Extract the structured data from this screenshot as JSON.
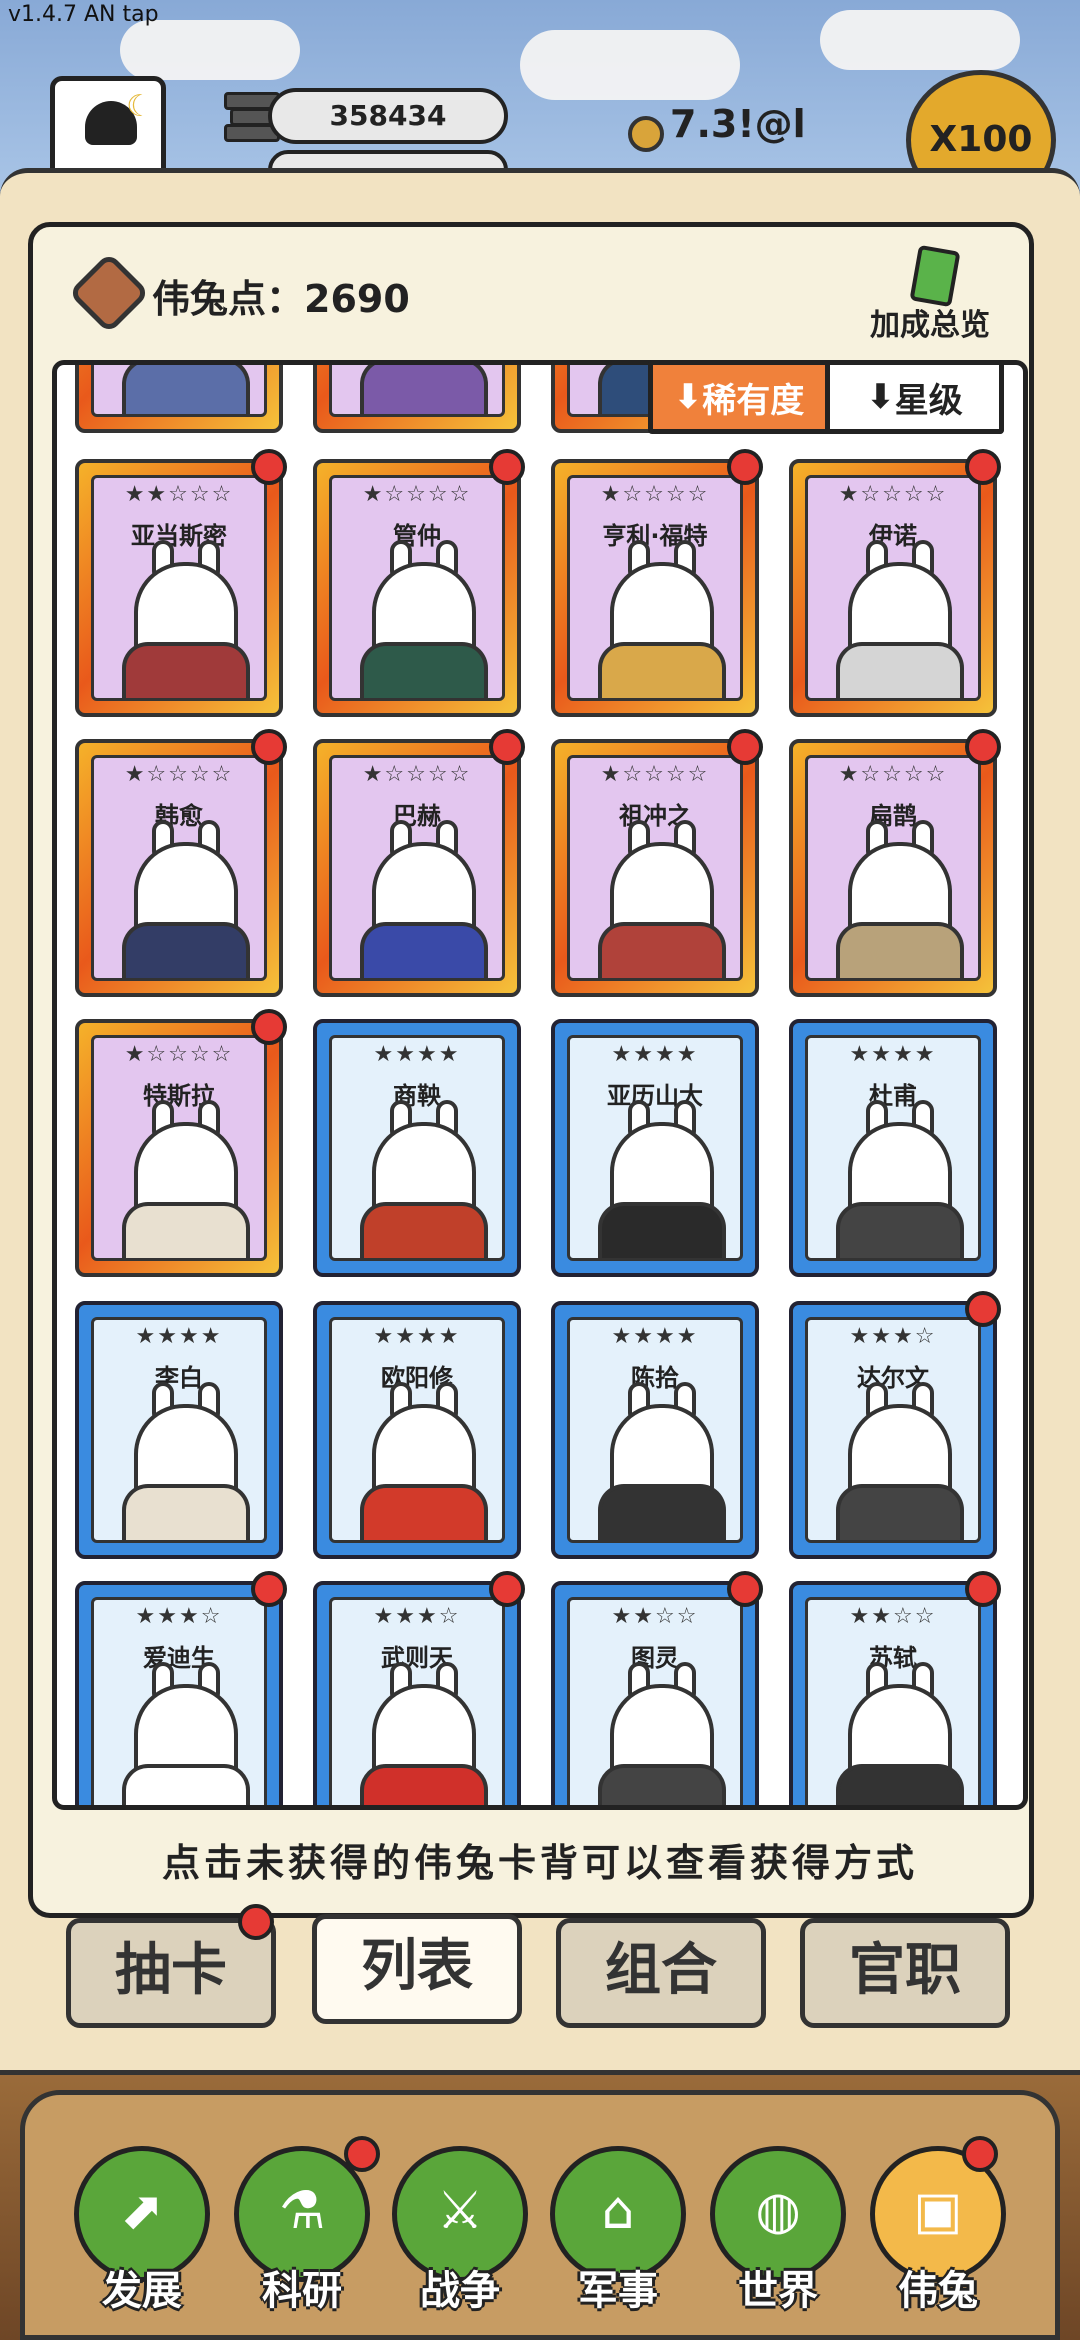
{
  "version": "v1.4.7 AN tap",
  "top": {
    "gold": "358434",
    "currency": "7.3!@l",
    "multiplier": "X100"
  },
  "points": {
    "label": "伟兔点：",
    "value": "2690"
  },
  "bonus_label": "加成总览",
  "sort": {
    "rarity": "稀有度",
    "star": "星级"
  },
  "cards": [
    {
      "name": "",
      "type": "purple",
      "stars": "",
      "dot": false
    },
    {
      "name": "",
      "type": "purple",
      "stars": "",
      "dot": false
    },
    {
      "name": "",
      "type": "purple",
      "stars": "",
      "dot": false
    },
    {
      "name": "",
      "type": "purple",
      "stars": "",
      "dot": false
    },
    {
      "name": "亚当斯密",
      "type": "purple",
      "stars": "★★☆☆☆",
      "dot": true
    },
    {
      "name": "管仲",
      "type": "purple",
      "stars": "★☆☆☆☆",
      "dot": true
    },
    {
      "name": "亨利·福特",
      "type": "purple",
      "stars": "★☆☆☆☆",
      "dot": true
    },
    {
      "name": "伊诺",
      "type": "purple",
      "stars": "★☆☆☆☆",
      "dot": true
    },
    {
      "name": "韩愈",
      "type": "purple",
      "stars": "★☆☆☆☆",
      "dot": true
    },
    {
      "name": "巴赫",
      "type": "purple",
      "stars": "★☆☆☆☆",
      "dot": true
    },
    {
      "name": "祖冲之",
      "type": "purple",
      "stars": "★☆☆☆☆",
      "dot": true
    },
    {
      "name": "扁鹊",
      "type": "purple",
      "stars": "★☆☆☆☆",
      "dot": true
    },
    {
      "name": "特斯拉",
      "type": "purple",
      "stars": "★☆☆☆☆",
      "dot": true
    },
    {
      "name": "商鞅",
      "type": "blue",
      "stars": "★★★★",
      "dot": false
    },
    {
      "name": "亚历山大",
      "type": "blue",
      "stars": "★★★★",
      "dot": false
    },
    {
      "name": "杜甫",
      "type": "blue",
      "stars": "★★★★",
      "dot": false
    },
    {
      "name": "李白",
      "type": "blue",
      "stars": "★★★★",
      "dot": false
    },
    {
      "name": "欧阳修",
      "type": "blue",
      "stars": "★★★★",
      "dot": false
    },
    {
      "name": "陈拾",
      "type": "blue",
      "stars": "★★★★",
      "dot": false
    },
    {
      "name": "达尔文",
      "type": "blue",
      "stars": "★★★☆",
      "dot": true
    },
    {
      "name": "爱迪生",
      "type": "blue",
      "stars": "★★★☆",
      "dot": true
    },
    {
      "name": "武则天",
      "type": "blue",
      "stars": "★★★☆",
      "dot": true
    },
    {
      "name": "图灵",
      "type": "blue",
      "stars": "★★☆☆",
      "dot": true
    },
    {
      "name": "苏轼",
      "type": "blue",
      "stars": "★★☆☆",
      "dot": true
    }
  ],
  "hint": "点击未获得的伟兔卡背可以查看获得方式",
  "tabs": [
    "抽卡",
    "列表",
    "组合",
    "官职"
  ],
  "nav": [
    "发展",
    "科研",
    "战争",
    "军事",
    "世界",
    "伟兔"
  ],
  "colors": {
    "purple_face": "#e3c6ef",
    "blue_frame": "#3a8be0",
    "badge": "#e63a35",
    "nav_green": "#5aa63a"
  }
}
